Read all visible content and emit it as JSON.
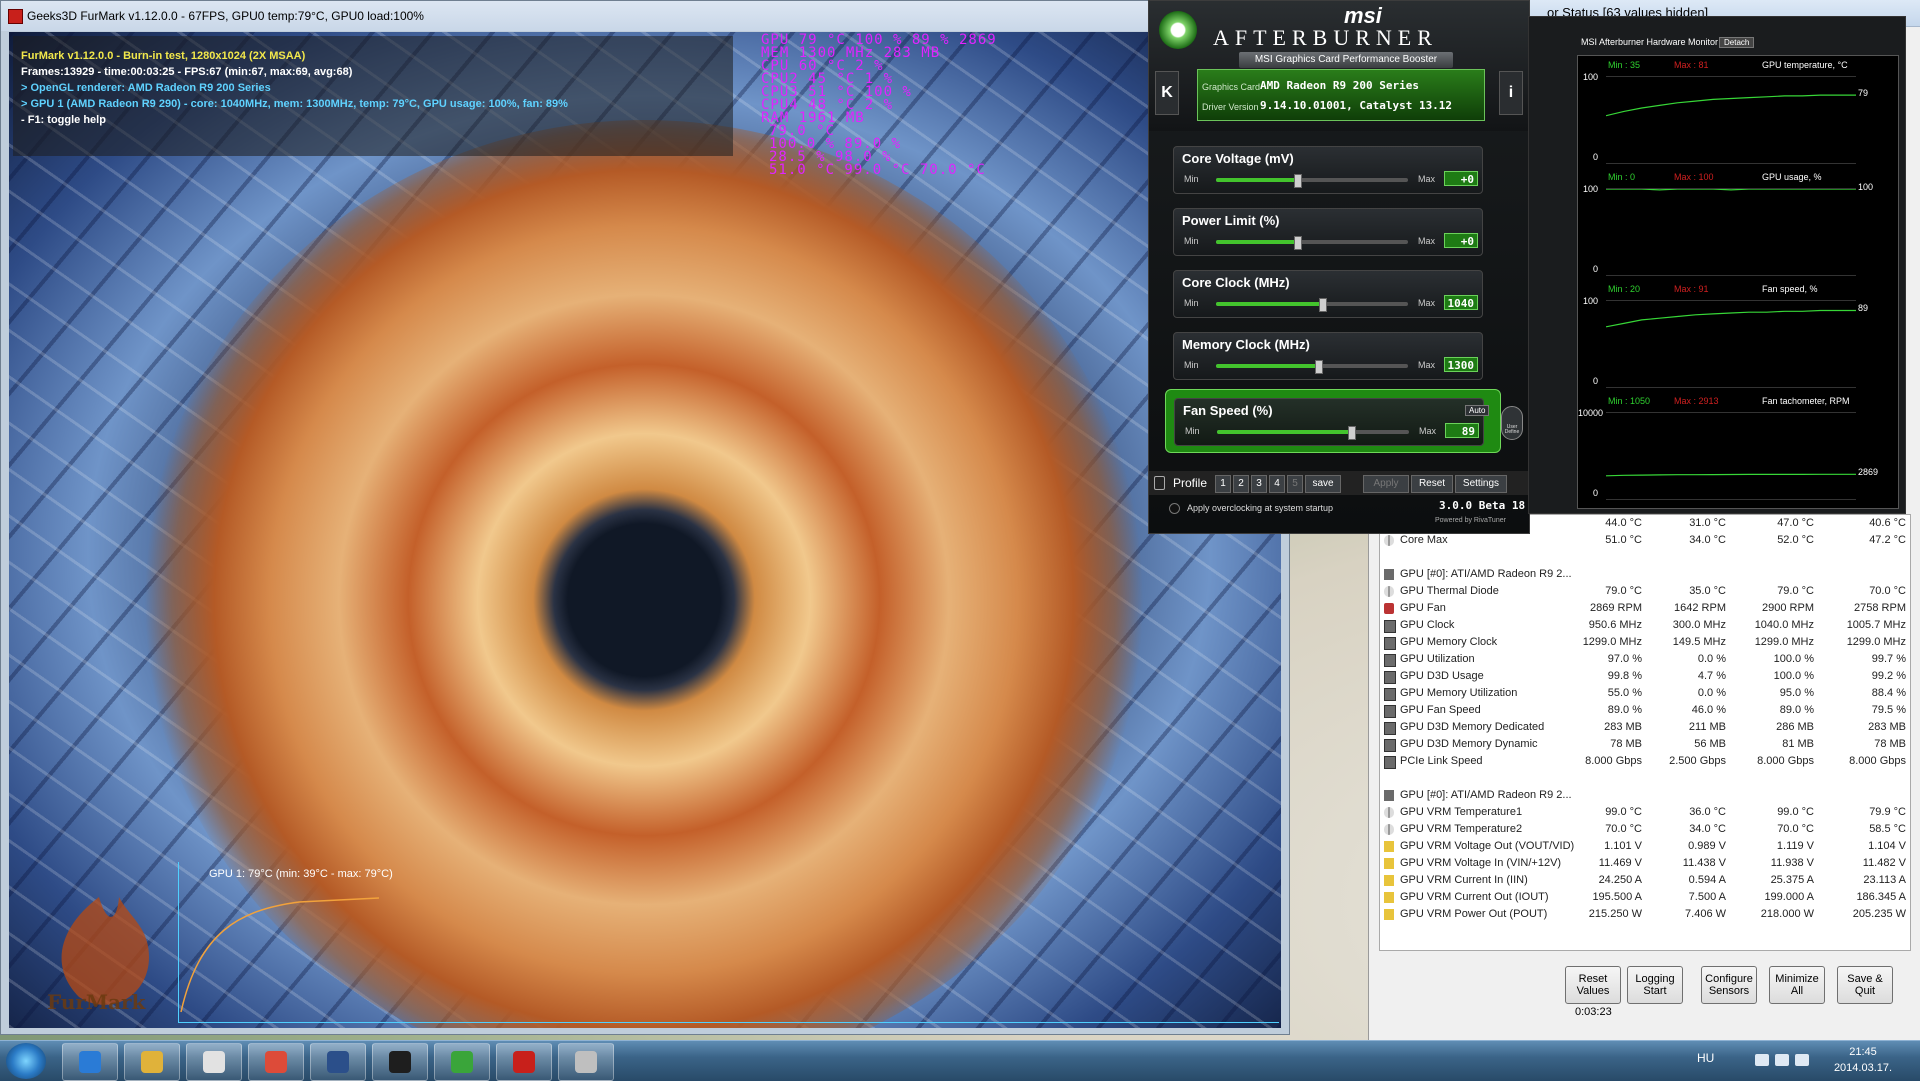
{
  "colors": {
    "osd_magenta": "#e024ff",
    "furmark_yellow": "#f2e84b",
    "furmark_cyan": "#5fd2ff",
    "ab_green": "#43c42d",
    "abm_min_green": "#2fd12f",
    "abm_max_red": "#d02020"
  },
  "furmark": {
    "window_title": "Geeks3D FurMark v1.12.0.0 - 67FPS, GPU0 temp:79°C, GPU0 load:100%",
    "info": [
      "FurMark v1.12.0.0 - Burn-in test, 1280x1024 (2X MSAA)",
      "Frames:13929 - time:00:03:25 - FPS:67 (min:67, max:69, avg:68)",
      "> OpenGL renderer: AMD Radeon R9 200 Series",
      "> GPU 1 (AMD Radeon R9 290) - core: 1040MHz, mem: 1300MHz, temp: 79°C, GPU usage: 100%, fan: 89%",
      "- F1: toggle help"
    ],
    "osd": [
      "GPU      79 °C  100 %  89 %  2869",
      "MEM      1300 MHz  283 MB",
      "CPU      60 °C  2 %",
      "CPU2     45 °C  1 %",
      "CPU3     51 °C  100 %",
      "CPU4     48 °C  2 %",
      "RAM      1961 MB",
      "79.0 °C",
      "100.0 %  89.0 %",
      "28.5 %  98.0 %",
      "51.0 °C  99.0 °C  70.0 °C"
    ],
    "graph_label": "GPU 1: 79°C (min: 39°C - max: 79°C)",
    "logo_text": "FurMark"
  },
  "afterburner": {
    "brand_small": "msi",
    "brand": "AFTERBURNER",
    "subtitle": "MSI Graphics Card Performance Booster",
    "card_label": "Graphics Card",
    "card_value": "AMD Radeon R9 200 Series",
    "driver_label": "Driver Version",
    "driver_value": "9.14.10.01001, Catalyst 13.12",
    "left_btn": "K",
    "right_btn": "i",
    "sliders": [
      {
        "label": "Core Voltage (mV)",
        "min": "Min",
        "max": "Max",
        "value": "+0",
        "level": 0.42
      },
      {
        "label": "Power Limit (%)",
        "min": "Min",
        "max": "Max",
        "value": "+0",
        "level": 0.42
      },
      {
        "label": "Core Clock (MHz)",
        "min": "Min",
        "max": "Max",
        "value": "1040",
        "level": 0.55
      },
      {
        "label": "Memory Clock (MHz)",
        "min": "Min",
        "max": "Max",
        "value": "1300",
        "level": 0.53
      },
      {
        "label": "Fan Speed (%)",
        "min": "Min",
        "max": "Max",
        "value": "89",
        "level": 0.7
      }
    ],
    "auto_label": "Auto",
    "user_define": "User Define",
    "profile": {
      "label": "Profile",
      "slots": [
        "1",
        "2",
        "3",
        "4",
        "5"
      ],
      "save": "save",
      "apply": "Apply",
      "reset": "Reset",
      "settings": "Settings"
    },
    "startup": "Apply overclocking at system startup",
    "version": "3.0.0 Beta 18",
    "powered": "Powered by RivaTuner"
  },
  "monitor": {
    "title": "MSI Afterburner Hardware Monitor",
    "detach": "Detach",
    "graphs": [
      {
        "min": "Min : 35",
        "max": "Max : 81",
        "name": "GPU temperature, °C",
        "ytop": "100",
        "ybot": "0",
        "current": "79",
        "values": [
          55,
          60,
          64,
          67,
          70,
          72,
          74,
          75,
          76,
          77,
          78,
          78,
          79,
          79,
          79
        ]
      },
      {
        "min": "Min : 0",
        "max": "Max : 100",
        "name": "GPU usage, %",
        "ytop": "100",
        "ybot": "0",
        "current": "100",
        "values": [
          100,
          100,
          100,
          99,
          100,
          100,
          100,
          99,
          100,
          100,
          100,
          100,
          100,
          100,
          100
        ]
      },
      {
        "min": "Min : 20",
        "max": "Max : 91",
        "name": "Fan speed, %",
        "ytop": "100",
        "ybot": "0",
        "current": "89",
        "values": [
          70,
          74,
          78,
          80,
          82,
          84,
          85,
          86,
          87,
          87,
          88,
          88,
          89,
          89,
          89
        ]
      },
      {
        "min": "Min : 1050",
        "max": "Max : 2913",
        "name": "Fan tachometer, RPM",
        "ytop": "10000",
        "ybot": "0",
        "current": "2869",
        "values": [
          2700,
          2750,
          2780,
          2800,
          2820,
          2830,
          2840,
          2850,
          2855,
          2860,
          2862,
          2865,
          2867,
          2868,
          2869
        ]
      }
    ]
  },
  "hwinfo": {
    "title": "or Status [63 values hidden]",
    "rows": [
      {
        "icon": "therm",
        "name": "",
        "v": [
          "44.0 °C",
          "31.0 °C",
          "47.0 °C",
          "40.6 °C"
        ]
      },
      {
        "icon": "therm",
        "name": "Core Max",
        "v": [
          "51.0 °C",
          "34.0 °C",
          "52.0 °C",
          "47.2 °C"
        ]
      },
      {
        "icon": "",
        "name": "",
        "v": [
          "",
          "",
          "",
          ""
        ]
      },
      {
        "icon": "gpu",
        "name": "GPU [#0]: ATI/AMD Radeon R9 2...",
        "v": [
          "",
          "",
          "",
          ""
        ]
      },
      {
        "icon": "therm",
        "name": "GPU Thermal Diode",
        "v": [
          "79.0 °C",
          "35.0 °C",
          "79.0 °C",
          "70.0 °C"
        ]
      },
      {
        "icon": "fan",
        "name": "GPU Fan",
        "v": [
          "2869 RPM",
          "1642 RPM",
          "2900 RPM",
          "2758 RPM"
        ]
      },
      {
        "icon": "chip",
        "name": "GPU Clock",
        "v": [
          "950.6 MHz",
          "300.0 MHz",
          "1040.0 MHz",
          "1005.7 MHz"
        ]
      },
      {
        "icon": "chip",
        "name": "GPU Memory Clock",
        "v": [
          "1299.0 MHz",
          "149.5 MHz",
          "1299.0 MHz",
          "1299.0 MHz"
        ]
      },
      {
        "icon": "chip",
        "name": "GPU Utilization",
        "v": [
          "97.0 %",
          "0.0 %",
          "100.0 %",
          "99.7 %"
        ]
      },
      {
        "icon": "chip",
        "name": "GPU D3D Usage",
        "v": [
          "99.8 %",
          "4.7 %",
          "100.0 %",
          "99.2 %"
        ]
      },
      {
        "icon": "chip",
        "name": "GPU Memory Utilization",
        "v": [
          "55.0 %",
          "0.0 %",
          "95.0 %",
          "88.4 %"
        ]
      },
      {
        "icon": "chip",
        "name": "GPU Fan Speed",
        "v": [
          "89.0 %",
          "46.0 %",
          "89.0 %",
          "79.5 %"
        ]
      },
      {
        "icon": "chip",
        "name": "GPU D3D Memory Dedicated",
        "v": [
          "283 MB",
          "211 MB",
          "286 MB",
          "283 MB"
        ]
      },
      {
        "icon": "chip",
        "name": "GPU D3D Memory Dynamic",
        "v": [
          "78 MB",
          "56 MB",
          "81 MB",
          "78 MB"
        ]
      },
      {
        "icon": "chip",
        "name": "PCIe Link Speed",
        "v": [
          "8.000 Gbps",
          "2.500 Gbps",
          "8.000 Gbps",
          "8.000 Gbps"
        ]
      },
      {
        "icon": "",
        "name": "",
        "v": [
          "",
          "",
          "",
          ""
        ]
      },
      {
        "icon": "gpu",
        "name": "GPU [#0]: ATI/AMD Radeon R9 2...",
        "v": [
          "",
          "",
          "",
          ""
        ]
      },
      {
        "icon": "therm",
        "name": "GPU VRM Temperature1",
        "v": [
          "99.0 °C",
          "36.0 °C",
          "99.0 °C",
          "79.9 °C"
        ]
      },
      {
        "icon": "therm",
        "name": "GPU VRM Temperature2",
        "v": [
          "70.0 °C",
          "34.0 °C",
          "70.0 °C",
          "58.5 °C"
        ]
      },
      {
        "icon": "volt",
        "name": "GPU VRM Voltage Out (VOUT/VID)",
        "v": [
          "1.101 V",
          "0.989 V",
          "1.119 V",
          "1.104 V"
        ]
      },
      {
        "icon": "volt",
        "name": "GPU VRM Voltage In (VIN/+12V)",
        "v": [
          "11.469 V",
          "11.438 V",
          "11.938 V",
          "11.482 V"
        ]
      },
      {
        "icon": "volt",
        "name": "GPU VRM Current In (IIN)",
        "v": [
          "24.250 A",
          "0.594 A",
          "25.375 A",
          "23.113 A"
        ]
      },
      {
        "icon": "volt",
        "name": "GPU VRM Current Out (IOUT)",
        "v": [
          "195.500 A",
          "7.500 A",
          "199.000 A",
          "186.345 A"
        ]
      },
      {
        "icon": "volt",
        "name": "GPU VRM Power Out (POUT)",
        "v": [
          "215.250 W",
          "7.406 W",
          "218.000 W",
          "205.235 W"
        ]
      }
    ],
    "buttons": [
      "Reset Values",
      "Logging Start",
      "Configure Sensors",
      "Minimize All",
      "Save & Quit"
    ],
    "timer": "0:03:23"
  },
  "taskbar": {
    "lang": "HU",
    "time": "21:45",
    "date": "2014.03.17.",
    "apps": [
      "internet-explorer-icon",
      "explorer-icon",
      "media-player-icon",
      "chrome-icon",
      "floppy-icon",
      "steam-icon",
      "xbox-icon",
      "furmark-icon",
      "afterburner-icon"
    ]
  }
}
